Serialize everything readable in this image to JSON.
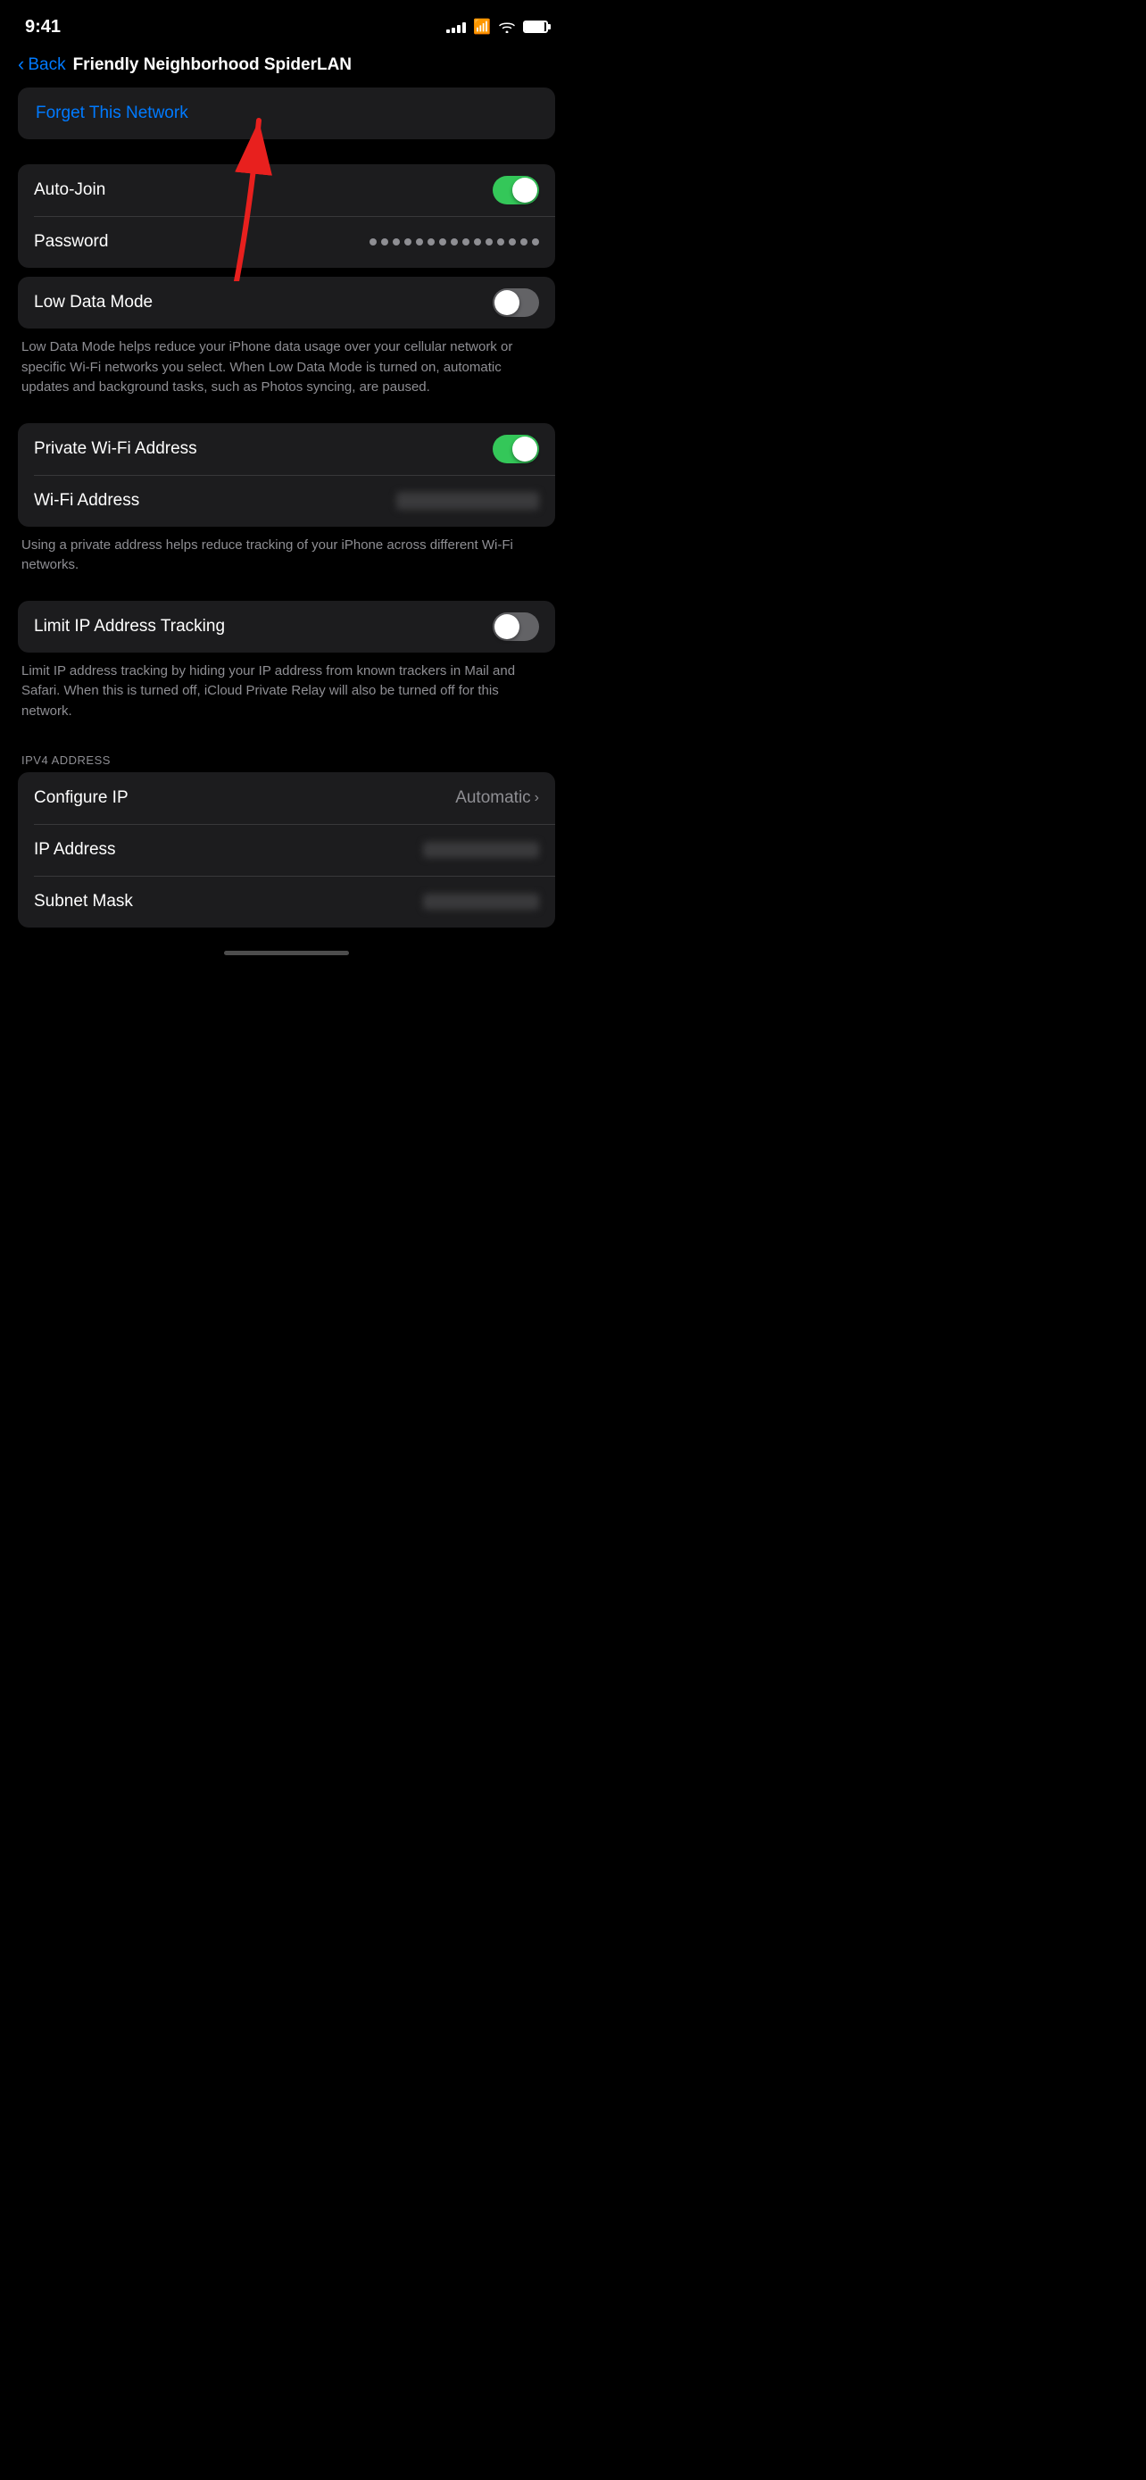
{
  "statusBar": {
    "time": "9:41",
    "signalBars": [
      3,
      5,
      7,
      9,
      11
    ],
    "batteryLevel": 90
  },
  "navigation": {
    "backLabel": "Back",
    "title": "Friendly Neighborhood SpiderLAN"
  },
  "forgetNetwork": {
    "label": "Forget This Network"
  },
  "autoJoin": {
    "label": "Auto-Join",
    "enabled": true
  },
  "password": {
    "label": "Password",
    "dotCount": 15
  },
  "lowDataMode": {
    "label": "Low Data Mode",
    "enabled": false,
    "description": "Low Data Mode helps reduce your iPhone data usage over your cellular network or specific Wi-Fi networks you select. When Low Data Mode is turned on, automatic updates and background tasks, such as Photos syncing, are paused."
  },
  "privateWifi": {
    "label": "Private Wi-Fi Address",
    "enabled": true
  },
  "wifiAddress": {
    "label": "Wi-Fi Address"
  },
  "wifiAddressDescription": "Using a private address helps reduce tracking of your iPhone across different Wi-Fi networks.",
  "limitIPTracking": {
    "label": "Limit IP Address Tracking",
    "enabled": false,
    "description": "Limit IP address tracking by hiding your IP address from known trackers in Mail and Safari. When this is turned off, iCloud Private Relay will also be turned off for this network."
  },
  "ipv4Section": {
    "headerLabel": "IPV4 ADDRESS"
  },
  "configureIP": {
    "label": "Configure IP",
    "value": "Automatic"
  },
  "ipAddress": {
    "label": "IP Address"
  },
  "subnetMask": {
    "label": "Subnet Mask"
  }
}
